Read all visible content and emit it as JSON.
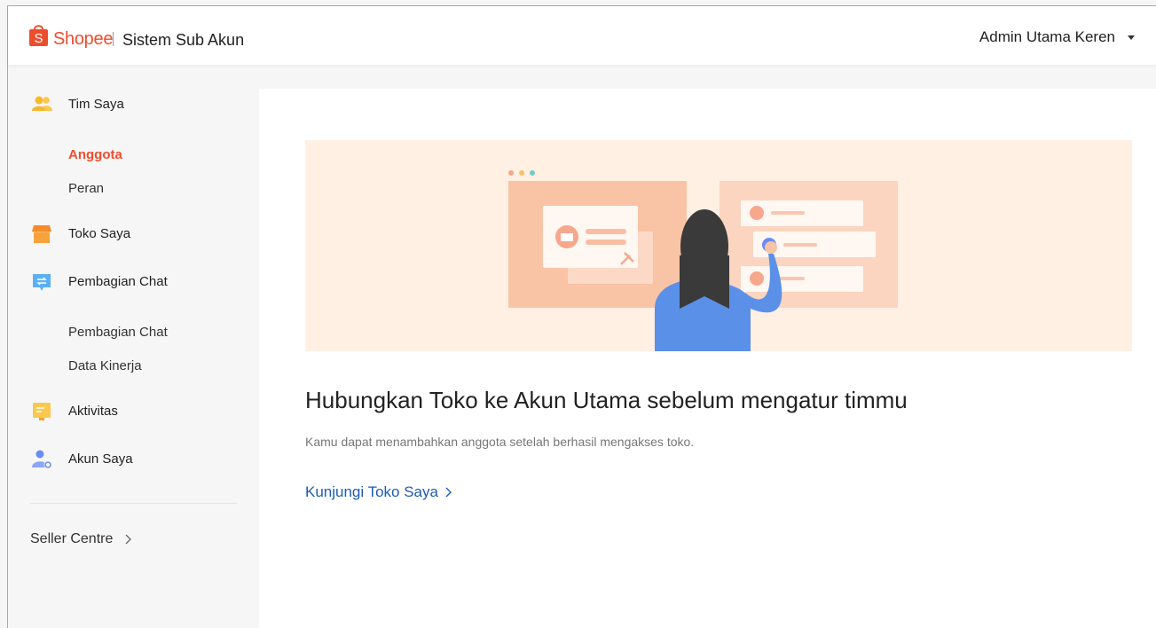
{
  "header": {
    "brand": "Shopee",
    "subtitle": "Sistem Sub Akun",
    "user_name": "Admin Utama Keren"
  },
  "sidebar": {
    "items": [
      {
        "label": "Tim Saya",
        "icon": "team-icon"
      },
      {
        "label": "Toko Saya",
        "icon": "shop-icon"
      },
      {
        "label": "Pembagian Chat",
        "icon": "chat-distribution-icon"
      },
      {
        "label": "Aktivitas",
        "icon": "activity-icon"
      },
      {
        "label": "Akun Saya",
        "icon": "account-settings-icon"
      }
    ],
    "tim_saya_sub": [
      "Anggota",
      "Peran"
    ],
    "pembagian_chat_sub": [
      "Pembagian Chat",
      "Data Kinerja"
    ],
    "seller_centre": "Seller Centre",
    "active_item": "Anggota"
  },
  "main": {
    "headline": "Hubungkan Toko ke Akun Utama sebelum mengatur timmu",
    "description": "Kamu dapat menambahkan anggota setelah berhasil mengakses toko.",
    "cta_label": "Kunjungi Toko Saya"
  },
  "colors": {
    "brand": "#ee4d2d",
    "link": "#1e5cb3",
    "banner_bg": "#fff0e3"
  }
}
